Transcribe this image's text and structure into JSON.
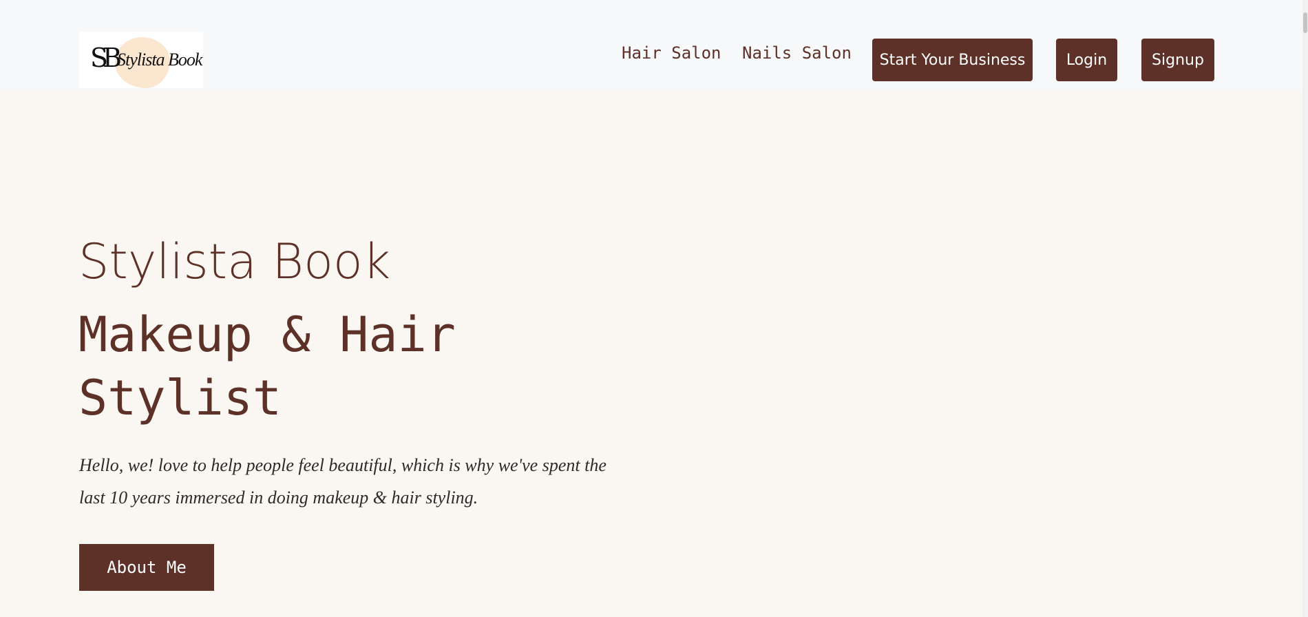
{
  "header": {
    "logo": {
      "monogram": "SB",
      "script": "Stylista Book"
    },
    "nav": {
      "hair_salon": "Hair Salon",
      "nails_salon": "Nails Salon",
      "start_business": "Start Your Business",
      "login": "Login",
      "signup": "Signup"
    }
  },
  "hero": {
    "brand": "Stylista Book",
    "title_line1": "Makeup & Hair",
    "title_line2": "Stylist",
    "description": "Hello, we! love to help people feel beautiful, which is why we've spent the last 10 years immersed in doing makeup & hair styling.",
    "button": "About Me"
  },
  "colors": {
    "accent": "#5e3128",
    "page_background": "#faf7f3",
    "header_background": "#f7f8fa",
    "logo_blob": "#fbe6cf"
  }
}
